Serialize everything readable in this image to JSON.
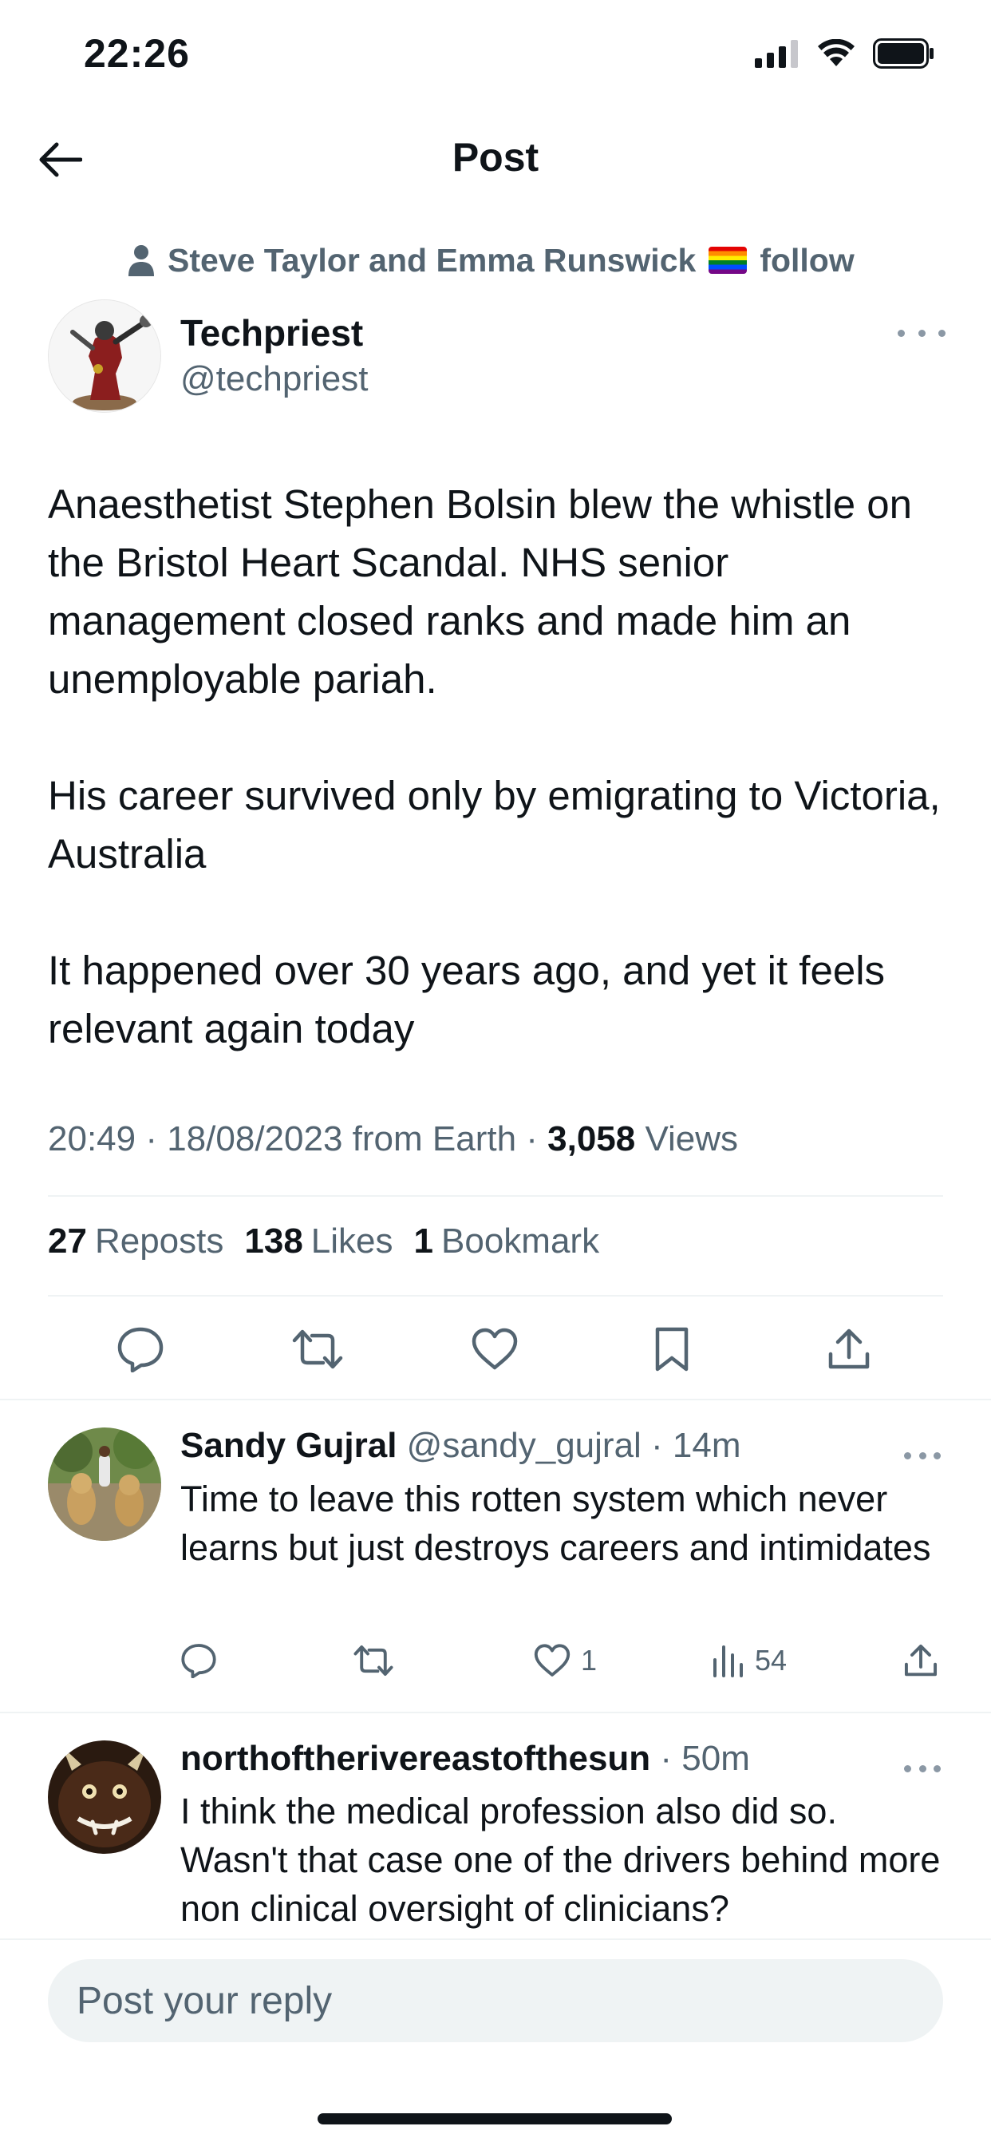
{
  "status_bar": {
    "time": "22:26"
  },
  "header": {
    "title": "Post"
  },
  "social_context": {
    "text": "Steve Taylor and Emma Runswick",
    "suffix": "follow"
  },
  "post": {
    "author_name": "Techpriest",
    "author_handle": "@techpriest",
    "paragraphs": [
      "Anaesthetist Stephen Bolsin blew the whistle on the Bristol Heart Scandal. NHS senior management closed ranks and made him an unemployable pariah.",
      "His career survived only by emigrating to Victoria, Australia",
      "It happened over 30 years ago, and yet it feels relevant again today"
    ],
    "meta_time": "20:49 · 18/08/2023 from Earth · ",
    "views_count": "3,058",
    "views_label": " Views",
    "reposts_count": "27",
    "reposts_label": "Reposts",
    "likes_count": "138",
    "likes_label": "Likes",
    "bookmarks_count": "1",
    "bookmarks_label": "Bookmark"
  },
  "replies": [
    {
      "name": "Sandy Gujral",
      "handle": "@sandy_gujral",
      "time": " · 14m",
      "text": "Time to leave this rotten system which never learns but just destroys careers and intimidates",
      "likes": "1",
      "views": "54"
    },
    {
      "name": "northoftherivereastofthesun",
      "handle": "",
      "time": " · 50m",
      "text": "I think the medical profession also did so. Wasn't that case one of the drivers behind more non clinical oversight of clinicians?"
    }
  ],
  "compose": {
    "placeholder": "Post your reply"
  },
  "icons": {
    "back": "arrow-left-icon",
    "reply": "speech-bubble-icon",
    "repost": "repost-arrows-icon",
    "like": "heart-icon",
    "bookmark": "bookmark-icon",
    "share": "share-upload-icon",
    "views": "bar-chart-icon",
    "more": "ellipsis-icon",
    "person": "person-icon"
  },
  "colors": {
    "text": "#0f1419",
    "secondary": "#536471",
    "divider": "#eff3f4"
  }
}
